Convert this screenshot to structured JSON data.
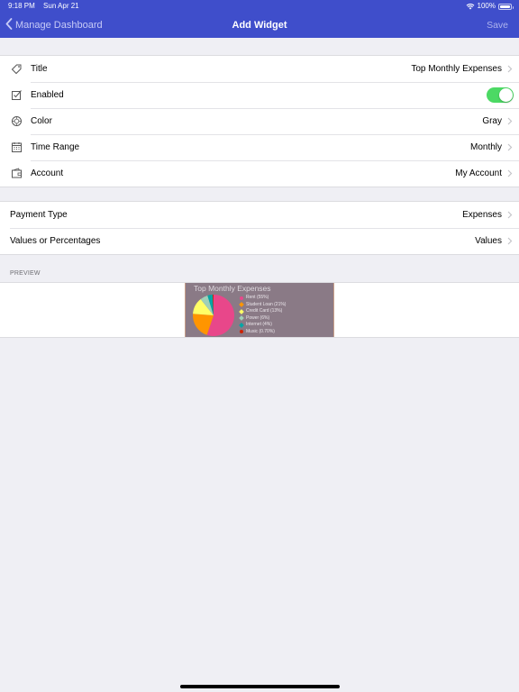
{
  "status_bar": {
    "time": "9:18 PM",
    "date": "Sun Apr 21",
    "battery": "100%"
  },
  "nav": {
    "back_label": "Manage Dashboard",
    "title": "Add Widget",
    "save_label": "Save"
  },
  "settings": {
    "title": {
      "label": "Title",
      "value": "Top Monthly Expenses",
      "icon": "tag-icon"
    },
    "enabled": {
      "label": "Enabled",
      "on": true,
      "icon": "checkbox-icon"
    },
    "color": {
      "label": "Color",
      "value": "Gray",
      "icon": "palette-icon"
    },
    "time_range": {
      "label": "Time Range",
      "value": "Monthly",
      "icon": "calendar-icon"
    },
    "account": {
      "label": "Account",
      "value": "My Account",
      "icon": "wallet-icon"
    }
  },
  "options": {
    "payment_type": {
      "label": "Payment Type",
      "value": "Expenses"
    },
    "values_or_percentages": {
      "label": "Values or Percentages",
      "value": "Values"
    }
  },
  "preview": {
    "header": "PREVIEW",
    "widget_title": "Top Monthly Expenses",
    "legend": [
      {
        "label": "Rent (55%)",
        "color": "#e8478a"
      },
      {
        "label": "Student Loan (21%)",
        "color": "#ff9500"
      },
      {
        "label": "Credit Card (13%)",
        "color": "#ffff66"
      },
      {
        "label": "Power  (6%)",
        "color": "#9fd0b8"
      },
      {
        "label": "Internet  (4%)",
        "color": "#00a6a6"
      },
      {
        "label": "Music (0.70%)",
        "color": "#cc2200"
      }
    ],
    "slices": [
      55,
      21,
      13,
      6,
      4,
      0.7
    ]
  }
}
